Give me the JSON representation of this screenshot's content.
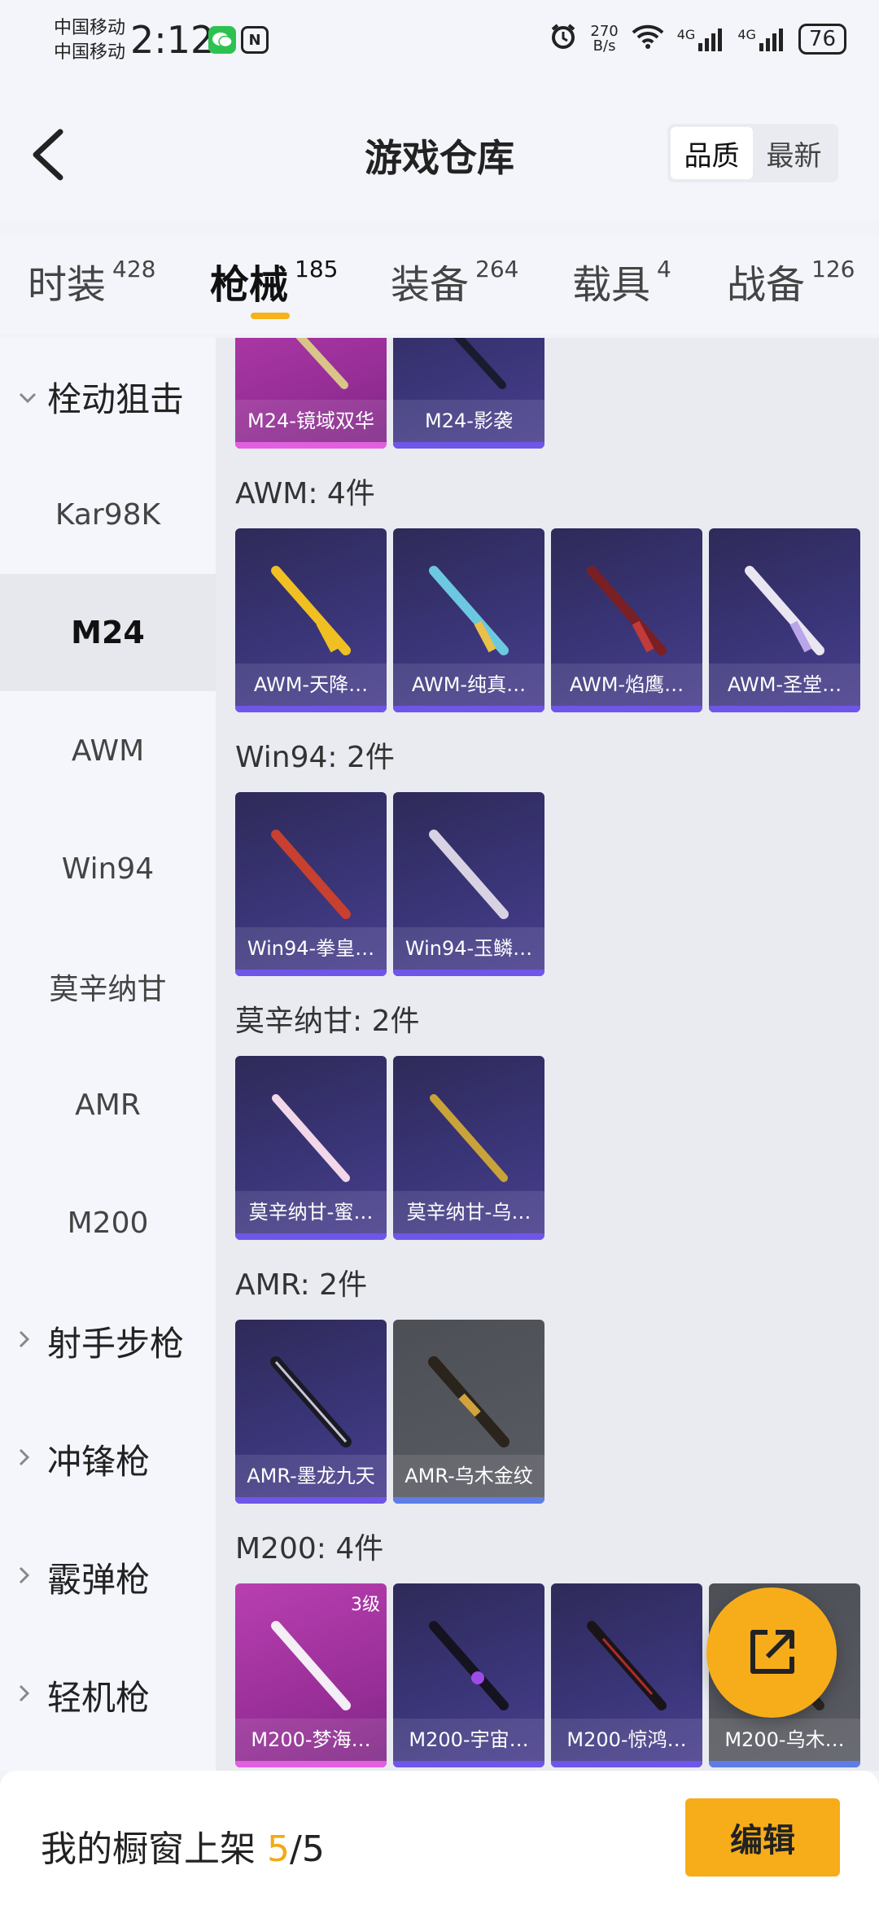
{
  "status_bar": {
    "carrier1": "中国移动",
    "carrier2": "中国移动",
    "time": "2:12",
    "speed_top": "270",
    "speed_bottom": "B/s",
    "network1": "4G",
    "network2": "4G",
    "battery": "76",
    "icons": [
      "wechat-icon",
      "nfc-icon",
      "alarm-icon",
      "wifi-icon",
      "signal-icon",
      "signal-icon",
      "battery-icon"
    ]
  },
  "header": {
    "title": "游戏仓库",
    "sort": {
      "options": [
        "品质",
        "最新"
      ],
      "selected": "品质"
    }
  },
  "tabs": [
    {
      "label": "时装",
      "count": "428"
    },
    {
      "label": "枪械",
      "count": "185",
      "active": true
    },
    {
      "label": "装备",
      "count": "264"
    },
    {
      "label": "载具",
      "count": "4"
    },
    {
      "label": "战备",
      "count": "126"
    }
  ],
  "sidebar": {
    "group_open": "栓动狙击",
    "items": [
      "Kar98K",
      "M24",
      "AWM",
      "Win94",
      "莫辛纳甘",
      "AMR",
      "M200"
    ],
    "selected": "M24",
    "groups_collapsed": [
      "射手步枪",
      "冲锋枪",
      "霰弹枪",
      "轻机枪"
    ]
  },
  "sections": [
    {
      "title": "",
      "items": [
        "M24-镜域双华",
        "M24-影袭"
      ]
    },
    {
      "title": "AWM: 4件",
      "items": [
        "AWM-天降…",
        "AWM-纯真…",
        "AWM-焰鹰…",
        "AWM-圣堂…"
      ]
    },
    {
      "title": "Win94: 2件",
      "items": [
        "Win94-拳皇…",
        "Win94-玉鳞…"
      ]
    },
    {
      "title": "莫辛纳甘: 2件",
      "items": [
        "莫辛纳甘-蜜…",
        "莫辛纳甘-乌…"
      ]
    },
    {
      "title": "AMR: 2件",
      "items": [
        "AMR-墨龙九天",
        "AMR-乌木金纹"
      ]
    },
    {
      "title": "M200: 4件",
      "items": [
        "M200-梦海…",
        "M200-宇宙…",
        "M200-惊鸿…",
        "M200-乌木…"
      ],
      "level_badge": "3级"
    }
  ],
  "colors": {
    "accent": "#f6ad19",
    "card_purple": "#3a3578",
    "card_pink": "#9a2f99",
    "card_grey": "#5a5c63"
  },
  "bottom_bar": {
    "label": "我的橱窗上架",
    "current": "5",
    "separator": "/",
    "total": "5",
    "edit_label": "编辑"
  }
}
